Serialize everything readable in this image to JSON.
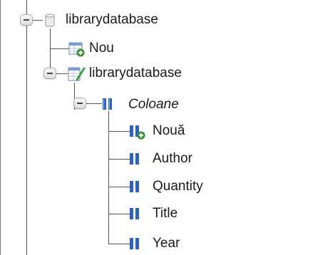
{
  "tree": {
    "root": {
      "label": "librarydatabase",
      "icon": "database-icon",
      "expanded": true
    },
    "new_table": {
      "label": "Nou",
      "icon": "new-table-icon"
    },
    "table": {
      "label": "librarydatabase",
      "icon": "table-icon",
      "expanded": true
    },
    "columns_group": {
      "label": "Coloane",
      "icon": "columns-icon",
      "expanded": true
    },
    "columns": [
      {
        "label": "Nouă",
        "icon": "new-column-icon"
      },
      {
        "label": "Author",
        "icon": "column-icon"
      },
      {
        "label": "Quantity",
        "icon": "column-icon"
      },
      {
        "label": "Title",
        "icon": "column-icon"
      },
      {
        "label": "Year",
        "icon": "column-icon"
      }
    ]
  },
  "colors": {
    "tree_line": "#555555",
    "column_icon_blue": "#2a62c8",
    "add_badge_green": "#3aa23a"
  }
}
